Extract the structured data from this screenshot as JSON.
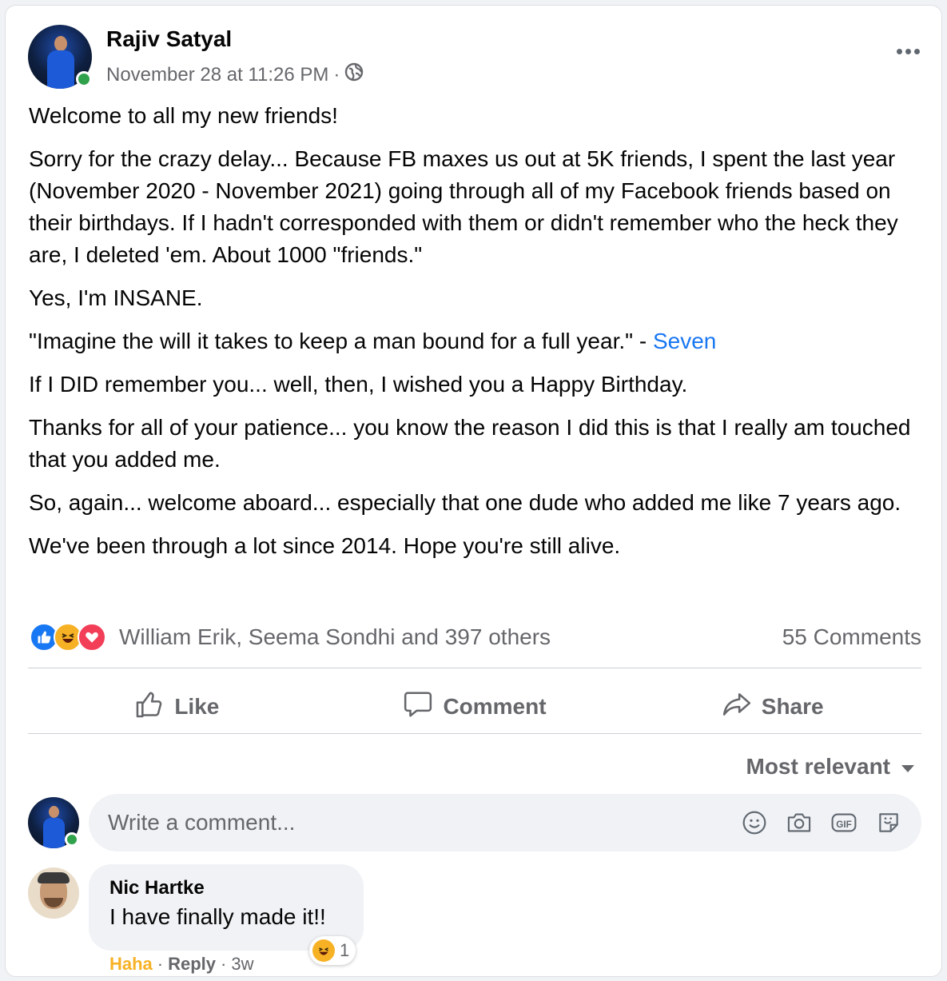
{
  "post": {
    "author": "Rajiv Satyal",
    "timestamp": "November 28 at 11:26 PM",
    "separator": "·",
    "privacy_icon": "globe-icon",
    "paragraphs": [
      "Welcome to all my new friends!",
      "Sorry for the crazy delay... Because FB maxes us out at 5K friends, I spent the last year (November 2020 - November 2021) going through all of my Facebook friends based on their birthdays.  If I hadn't corresponded with them or didn't remember who the heck they are, I deleted 'em.  About 1000 \"friends.\"",
      "Yes, I'm INSANE.",
      "\"Imagine the will it takes to keep a man bound for a full year.\" - ",
      "If I DID remember you... well, then, I wished you a Happy Birthday.",
      "Thanks for all of your patience... you know the reason I did this is that I really am touched that you added me.",
      "So, again... welcome aboard... especially that one dude who added me like 7 years ago.",
      "We've been through a lot since 2014.  Hope you're still alive."
    ],
    "quote_link": "Seven"
  },
  "reactions": {
    "icons": [
      "like-icon",
      "haha-icon",
      "love-icon"
    ],
    "summary": "William Erik, Seema Sondhi and 397 others",
    "comments_count": "55 Comments"
  },
  "actions": {
    "like": "Like",
    "comment": "Comment",
    "share": "Share"
  },
  "sort": {
    "label": "Most relevant"
  },
  "composer": {
    "placeholder": "Write a comment...",
    "tools": [
      "emoji-icon",
      "camera-icon",
      "gif-icon",
      "sticker-icon"
    ]
  },
  "comment": {
    "author": "Nic Hartke",
    "text": "I have finally made it!!",
    "reaction_count": "1",
    "my_reaction": "Haha",
    "reply": "Reply",
    "age": "3w",
    "separator": "·"
  },
  "colors": {
    "link": "#1877f2",
    "online": "#31a24c",
    "haha": "#f7b125",
    "love": "#f33e58",
    "secondary_text": "#65676b"
  }
}
